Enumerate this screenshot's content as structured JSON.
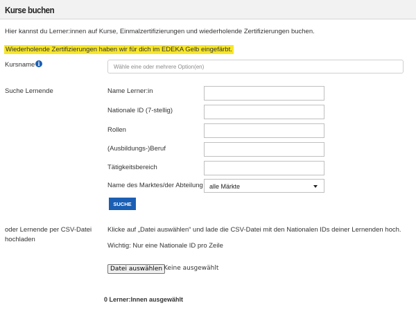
{
  "header": {
    "title": "Kurse buchen"
  },
  "intro_text": "Hier kannst du Lerner:innen auf Kurse, Einmalzertifizierungen und wiederholende Zertifizierungen buchen.",
  "highlight_text": "Wiederholende Zertifizierungen haben wir für dich im EDEKA Gelb eingefärbt.",
  "kursname": {
    "label": "Kursname",
    "info_icon": "info-icon",
    "info_glyph": "i",
    "placeholder": "Wähle eine oder mehrere Option(en)",
    "value": ""
  },
  "search": {
    "section_label": "Suche Lernende",
    "fields": [
      {
        "label": "Name Lerner:in",
        "value": ""
      },
      {
        "label": "Nationale ID (7-stellig)",
        "value": ""
      },
      {
        "label": "Rollen",
        "value": ""
      },
      {
        "label": "(Ausbildungs-)Beruf",
        "value": ""
      },
      {
        "label": "Tätigkeitsbereich",
        "value": ""
      }
    ],
    "market": {
      "label": "Name des Marktes/der Abteilung",
      "selected": "alle Märkte",
      "caret_icon": "caret-down-icon"
    },
    "button_label": "SUCHE"
  },
  "csv": {
    "section_label_line1": "oder Lernende per CSV-Datei",
    "section_label_line2": "hochladen",
    "instruction": "Klicke auf „Datei auswählen“ und lade die CSV-Datei mit den Nationalen IDs deiner Lernenden hoch.",
    "note": "Wichtig: Nur eine Nationale ID pro Zeile",
    "file_button_label": "Datei auswählen",
    "file_status": "Keine ausgewählt"
  },
  "selected_count_text": "0 Lerner:Innen ausgewählt",
  "colors": {
    "highlight_yellow": "#f7e629",
    "button_blue": "#1a5fb4",
    "info_blue": "#1a5fb4",
    "header_bg": "#f2f2f2"
  }
}
